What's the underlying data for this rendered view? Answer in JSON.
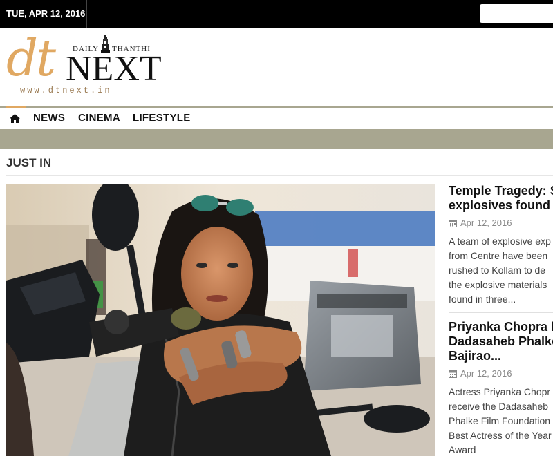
{
  "topbar": {
    "date": "TUE, APR 12, 2016",
    "search_placeholder": ""
  },
  "logo": {
    "dt": "dt",
    "next": "NEXT",
    "daily": "DAILY",
    "thanthi": "THANTHI",
    "url": "www.dtnext.in"
  },
  "nav": {
    "home_icon": "home-icon",
    "items": [
      {
        "label": "NEWS"
      },
      {
        "label": "CINEMA"
      },
      {
        "label": "LIFESTYLE"
      }
    ]
  },
  "section": {
    "title": "JUST IN"
  },
  "hero": {
    "icon": "photo-woman-on-motorcycle"
  },
  "articles": [
    {
      "headline_1": "Temple Tragedy: St",
      "headline_2": "explosives found in",
      "headline_3": "",
      "date": "Apr 12, 2016",
      "excerpt": [
        "A team of explosive exp",
        "from Centre have been",
        "rushed to Kollam to de",
        "the explosive materials",
        "found in three..."
      ]
    },
    {
      "headline_1": "Priyanka Chopra ba",
      "headline_2": "Dadasaheb Phalke",
      "headline_3": "Bajirao...",
      "date": "Apr 12, 2016",
      "excerpt": [
        "Actress Priyanka Chopr",
        "receive the Dadasaheb",
        "Phalke Film Foundation",
        "Best Actress of the Year",
        "Award"
      ]
    }
  ],
  "colors": {
    "accent": "#e0a862",
    "bar": "#a8a690",
    "topbar": "#000000"
  }
}
